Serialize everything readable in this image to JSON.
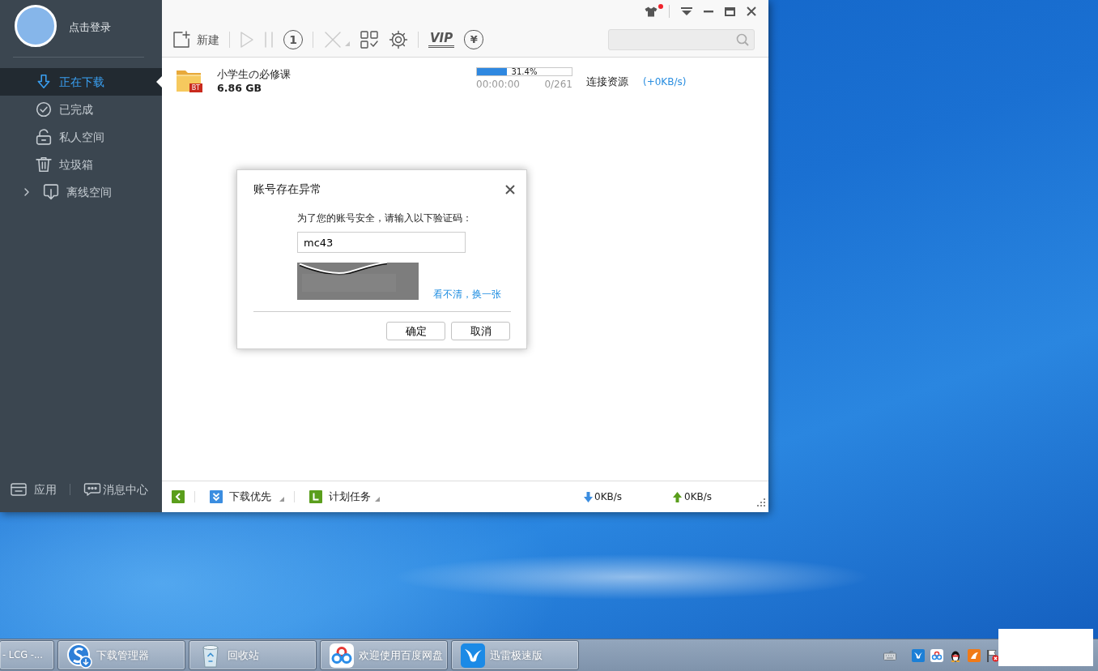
{
  "title_bar": {
    "skin_notification": true
  },
  "sidebar": {
    "login_label": "点击登录",
    "items": [
      {
        "kind": "item",
        "label": "正在下载",
        "selected": true
      },
      {
        "kind": "item",
        "label": "已完成",
        "selected": false
      },
      {
        "kind": "item",
        "label": "私人空间",
        "selected": false
      },
      {
        "kind": "item",
        "label": "垃圾箱",
        "selected": false
      },
      {
        "kind": "group",
        "label": "离线空间",
        "selected": false,
        "expanded": false
      }
    ],
    "footer": [
      {
        "label": "应用"
      },
      {
        "label": "消息中心"
      }
    ]
  },
  "toolbar": {
    "buttons": [
      {
        "label": "新建",
        "disabled": false
      },
      {
        "disabled": true
      },
      {
        "disabled": true
      },
      {
        "symbol": "1",
        "disabled": false
      },
      {
        "disabled": true
      },
      {
        "disabled": false
      },
      {
        "disabled": false
      },
      {
        "label": "VIP",
        "disabled": false
      },
      {
        "symbol": "¥",
        "disabled": false
      }
    ]
  },
  "tasks": [
    {
      "name": "小学生の必修课",
      "size": "6.86 GB",
      "badge": "BT",
      "progress": "31.4%",
      "level": 0.314,
      "elapsed": "00:00:00",
      "pieces": "0/261",
      "status": "连接资源",
      "speed": "(+0KB/s)"
    }
  ],
  "status_bar": {
    "items": [
      {
        "label": "下载优先"
      },
      {
        "label": "计划任务"
      }
    ],
    "download_speed": "0KB/s",
    "upload_speed": "0KB/s"
  },
  "dialog": {
    "title": "账号存在异常",
    "prompt": "为了您的账号安全，请输入以下验证码：",
    "code_value": "mc43",
    "refresh_link": "看不清，换一张",
    "buttons": [
      "确定",
      "取消"
    ]
  },
  "taskbar": {
    "items": [
      {
        "label": "- LCG -..."
      },
      {
        "label": "下载管理器"
      },
      {
        "label": "回收站"
      },
      {
        "label": "欢迎使用百度网盘"
      },
      {
        "label": "迅雷极速版"
      }
    ]
  }
}
